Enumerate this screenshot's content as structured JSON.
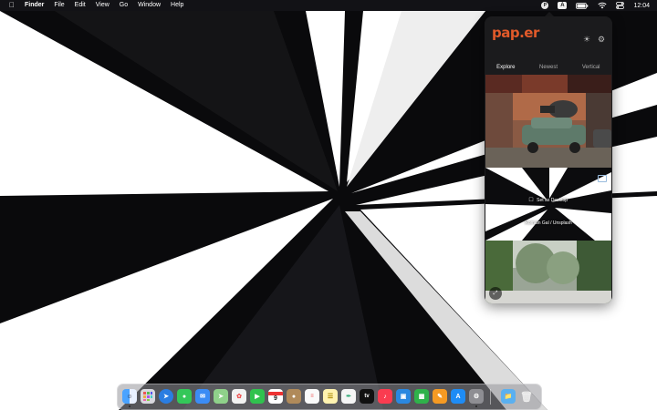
{
  "menubar": {
    "apple_icon": "apple-logo",
    "app_name": "Finder",
    "menus": [
      "File",
      "Edit",
      "View",
      "Go",
      "Window",
      "Help"
    ],
    "input_source": "A",
    "paper_indicator": "P",
    "clock": "12:04"
  },
  "panel": {
    "logo": "pap.er",
    "tabs": [
      {
        "label": "Explore",
        "active": true
      },
      {
        "label": "Newest",
        "active": false
      },
      {
        "label": "Vertical",
        "active": false
      }
    ],
    "set_desktop_label": "Set as Desktop",
    "credit": "Romain Gal / Unsplash"
  },
  "dock": {
    "apps": [
      "finder",
      "launchpad",
      "safari",
      "messages",
      "mail",
      "maps",
      "photos",
      "facetime",
      "calendar",
      "contacts",
      "reminders",
      "notes",
      "freeform",
      "apple-tv",
      "music",
      "keynote",
      "numbers",
      "pages",
      "app-store",
      "system-settings"
    ],
    "calendar_day": "9",
    "apple_tv_label": "tv"
  },
  "colors": {
    "logo": "#e15a2a",
    "menubar_bg": "#141418",
    "panel_bg": "#1b1b1d"
  }
}
